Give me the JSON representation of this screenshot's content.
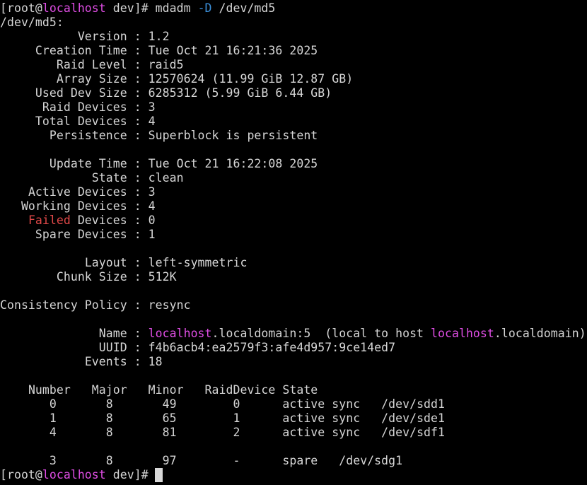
{
  "prompt": {
    "user": "root",
    "at": "@",
    "host": "localhost",
    "cwd": "dev",
    "open": "[",
    "close": "]",
    "symbol": "#",
    "command": "mdadm",
    "option": "-D",
    "argument": "/dev/md5"
  },
  "header": "/dev/md5:",
  "sep": " : ",
  "info": {
    "version": {
      "label": "Version",
      "value": "1.2"
    },
    "creation_time": {
      "label": "Creation Time",
      "value": "Tue Oct 21 16:21:36 2025"
    },
    "raid_level": {
      "label": "Raid Level",
      "value": "raid5"
    },
    "array_size": {
      "label": "Array Size",
      "value": "12570624 (11.99 GiB 12.87 GB)"
    },
    "used_dev_size": {
      "label": "Used Dev Size",
      "value": "6285312 (5.99 GiB 6.44 GB)"
    },
    "raid_devices": {
      "label": "Raid Devices",
      "value": "3"
    },
    "total_devices": {
      "label": "Total Devices",
      "value": "4"
    },
    "persistence": {
      "label": "Persistence",
      "value": "Superblock is persistent"
    },
    "update_time": {
      "label": "Update Time",
      "value": "Tue Oct 21 16:22:08 2025"
    },
    "state": {
      "label": "State",
      "value": "clean"
    },
    "active_devices": {
      "label": "Active Devices",
      "value": "3"
    },
    "working_devices": {
      "label": "Working Devices",
      "value": "4"
    },
    "failed_devices": {
      "label_a": "Failed",
      "label_b": " Devices",
      "value": "0"
    },
    "spare_devices": {
      "label": "Spare Devices",
      "value": "1"
    },
    "layout": {
      "label": "Layout",
      "value": "left-symmetric"
    },
    "chunk_size": {
      "label": "Chunk Size",
      "value": "512K"
    },
    "consistency_policy": {
      "label": "Consistency Policy",
      "value": "resync"
    },
    "name": {
      "label": "Name",
      "host1": "localhost",
      "mid": ".localdomain:5  (local to host ",
      "host2": "localhost",
      "tail": ".localdomain)"
    },
    "uuid": {
      "label": "UUID",
      "value": "f4b6acb4:ea2579f3:afe4d957:9ce14ed7"
    },
    "events": {
      "label": "Events",
      "value": "18"
    }
  },
  "table": {
    "headers": [
      "Number",
      "Major",
      "Minor",
      "RaidDevice",
      "State"
    ],
    "rows": [
      {
        "number": "0",
        "major": "8",
        "minor": "49",
        "raid": "0",
        "state": "active sync",
        "dev": "/dev/sdd1"
      },
      {
        "number": "1",
        "major": "8",
        "minor": "65",
        "raid": "1",
        "state": "active sync",
        "dev": "/dev/sde1"
      },
      {
        "number": "4",
        "major": "8",
        "minor": "81",
        "raid": "2",
        "state": "active sync",
        "dev": "/dev/sdf1"
      },
      {
        "number": "3",
        "major": "8",
        "minor": "97",
        "raid": "-",
        "state": "spare",
        "dev": "/dev/sdg1"
      }
    ]
  },
  "colors": {
    "background": "#000000",
    "text": "#d6d6d6",
    "hostname": "#e14ee6",
    "failed": "#e04848",
    "option": "#3b8fd9",
    "cursor": "#d8d8d8"
  }
}
